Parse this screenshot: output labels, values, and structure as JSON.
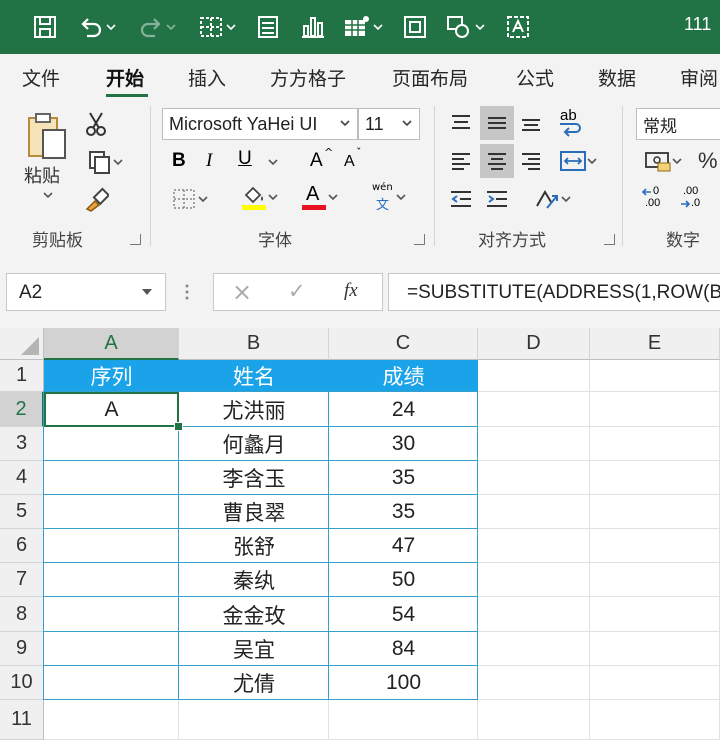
{
  "window": {
    "title": "111"
  },
  "ribbon_tabs": [
    "文件",
    "开始",
    "插入",
    "方方格子",
    "页面布局",
    "公式",
    "数据",
    "审阅"
  ],
  "active_tab": "开始",
  "clipboard": {
    "paste_label": "粘贴",
    "group_label": "剪贴板"
  },
  "font": {
    "name": "Microsoft YaHei UI",
    "size": "11",
    "group_label": "字体",
    "bold": "B",
    "italic": "I",
    "underline": "U",
    "grow": "A",
    "shrink": "A",
    "font_color_letter": "A",
    "phonetic_top": "wén",
    "phonetic_bottom": "文"
  },
  "alignment": {
    "group_label": "对齐方式",
    "wrap_glyph": "ab"
  },
  "number": {
    "format": "常规",
    "group_label": "数字",
    "percent": "%",
    "inc_decimal": ".00",
    "dec_decimal": ".00"
  },
  "colors": {
    "excel_green": "#217346",
    "header_fill": "#1aa3e8",
    "table_border": "#35a0cc",
    "fill_highlight": "#ffff00",
    "font_red": "#e81123"
  },
  "formula_bar": {
    "name_box": "A2",
    "cancel_icon": "×",
    "enter_icon": "✓",
    "fx_label": "fx",
    "formula": "=SUBSTITUTE(ADDRESS(1,ROW(B"
  },
  "sheet": {
    "columns": [
      "A",
      "B",
      "C",
      "D",
      "E"
    ],
    "rows": [
      "1",
      "2",
      "3",
      "4",
      "5",
      "6",
      "7",
      "8",
      "9",
      "10",
      "11"
    ],
    "header": [
      "序列",
      "姓名",
      "成绩"
    ],
    "data": [
      [
        "A",
        "尤洪丽",
        "24"
      ],
      [
        "",
        "何蠡月",
        "30"
      ],
      [
        "",
        "李含玉",
        "35"
      ],
      [
        "",
        "曹良翠",
        "35"
      ],
      [
        "",
        "张舒",
        "47"
      ],
      [
        "",
        "秦纨",
        "50"
      ],
      [
        "",
        "金金玫",
        "54"
      ],
      [
        "",
        "吴宜",
        "84"
      ],
      [
        "",
        "尤倩",
        "100"
      ]
    ]
  }
}
